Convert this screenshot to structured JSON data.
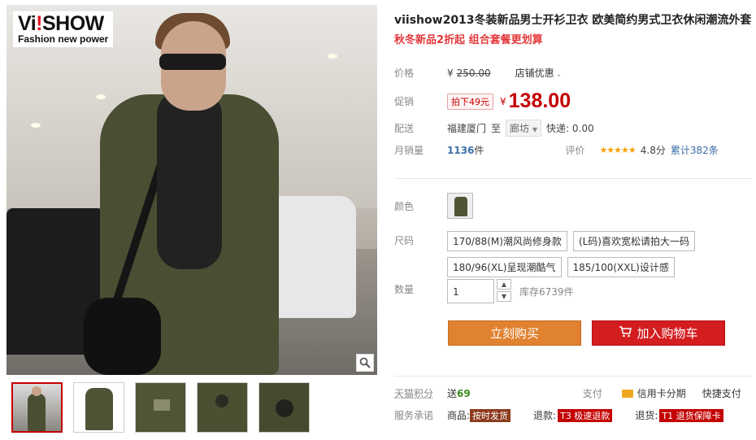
{
  "logo": {
    "brand_pre": "Vi",
    "brand_bang": "!",
    "brand_post": "SHOW",
    "tagline": "Fashion new power"
  },
  "product": {
    "title": "viishow2013冬装新品男士开衫卫衣 欧美简约男式卫衣休闲潮流外套",
    "subtitle": "秋冬新品2折起 组合套餐更划算"
  },
  "price_row": {
    "label": "价格",
    "yen": "¥",
    "original": "250.00",
    "store_promo": "店铺优惠"
  },
  "promo_row": {
    "label": "促销",
    "tag": "拍下49元",
    "yen": "¥",
    "price": "138.00"
  },
  "shipping_row": {
    "label": "配送",
    "origin": "福建厦门",
    "to": "至",
    "destination": "廊坊",
    "express": "快递: 0.00"
  },
  "sales_row": {
    "label": "月销量",
    "count": "1136",
    "unit": "件",
    "rating_label": "评价",
    "stars": "★★★★★",
    "score": "4.8分",
    "reviews": "累计382条"
  },
  "color_row": {
    "label": "颜色"
  },
  "size_row": {
    "label": "尺码",
    "options": [
      "170/88(M)潮风尚修身款",
      "(L码)喜欢宽松请拍大一码",
      "180/96(XL)呈现潮酷气",
      "185/100(XXL)设计感"
    ]
  },
  "qty_row": {
    "label": "数量",
    "value": "1",
    "stock": "库存6739件",
    "up": "▲",
    "down": "▼"
  },
  "buttons": {
    "buy": "立刻购买",
    "cart": "加入购物车"
  },
  "points_row": {
    "label": "天猫积分",
    "give": "送",
    "points": "69",
    "pay_label": "支付",
    "card_installment": "信用卡分期",
    "quick_pay": "快捷支付"
  },
  "service_row": {
    "label": "服务承诺",
    "goods": "商品:",
    "goods_tag": "按时发货",
    "refund": "退款:",
    "refund_tag": "T3 极速退款",
    "return": "退货:",
    "return_tag": "T1 退货保障卡"
  },
  "colors": {
    "accent_red": "#c40000",
    "buy_orange": "#e08230",
    "cart_red": "#d41d1f",
    "link_blue": "#3c6ea5"
  }
}
